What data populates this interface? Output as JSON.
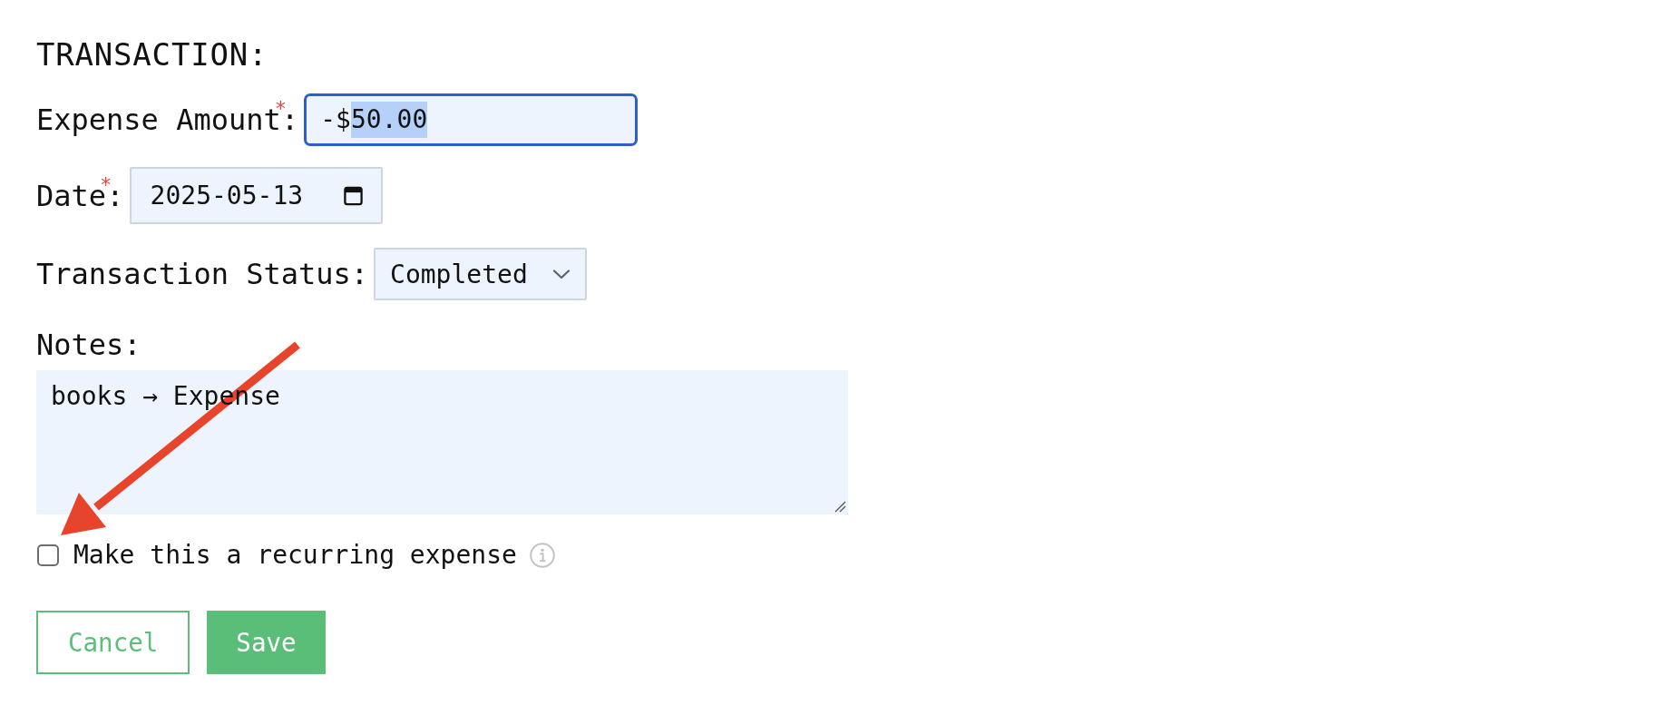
{
  "heading": "TRANSACTION:",
  "fields": [
    {
      "kind": "text",
      "label": "Expense Amount$^{*}$:",
      "focused": true,
      "value_parts": [
        {
          "text": "-$",
          "selected": false
        },
        {
          "text": "50.00",
          "selected": true
        }
      ]
    },
    {
      "kind": "date",
      "label": "Date$^{*}$:",
      "focused": false,
      "value": "2025-05-13"
    },
    {
      "kind": "select",
      "label": "Transaction Status:",
      "focused": false,
      "value": "Completed"
    }
  ],
  "notes": {
    "label": "Notes:",
    "value": "books → Expense"
  },
  "recurring": {
    "label": "Make this a recurring expense",
    "checked": false
  },
  "buttons": [
    {
      "kind": "outline",
      "label": "Cancel"
    },
    {
      "kind": "filled",
      "label": "Save"
    }
  ],
  "annotations": [
    {
      "kind": "arrow"
    }
  ]
}
